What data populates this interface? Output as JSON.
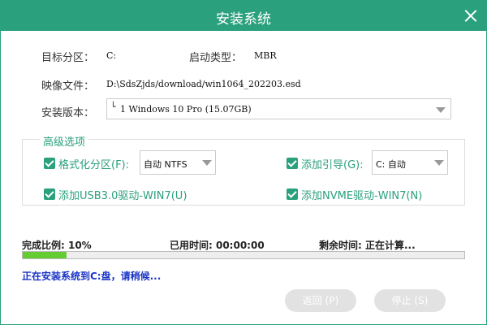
{
  "window": {
    "title": "安装系统"
  },
  "fields": {
    "target_partition_label": "目标分区：",
    "target_partition_value": "C:",
    "boot_type_label": "启动类型：",
    "boot_type_value": "MBR",
    "image_file_label": "映像文件：",
    "image_file_value": "D:\\SdsZjds/download/win1064_202203.esd",
    "version_label": "安装版本：",
    "version_value": "1 Windows 10 Pro (15.07GB)"
  },
  "advanced": {
    "title": "高级选项",
    "format_label": "格式化分区(F):",
    "format_checked": true,
    "format_select": "自动 NTFS",
    "boot_label": "添加引导(G):",
    "boot_checked": true,
    "boot_select": "C: 自动",
    "usb_label": "添加USB3.0驱动-WIN7(U)",
    "usb_checked": true,
    "nvme_label": "添加NVME驱动-WIN7(N)",
    "nvme_checked": true
  },
  "progress": {
    "percent_label": "完成比例: 10%",
    "percent": 10,
    "elapsed_label": "已用时间: 00:00:00",
    "remaining_label": "剩余时间: 正在计算..."
  },
  "status": "正在安装系统到C:盘，请稍候...",
  "buttons": {
    "back": "返回 (P)",
    "stop": "停止 (S)"
  },
  "colors": {
    "accent": "#2aa07c",
    "progress": "#66cc33",
    "status_text": "#1a35c8"
  }
}
